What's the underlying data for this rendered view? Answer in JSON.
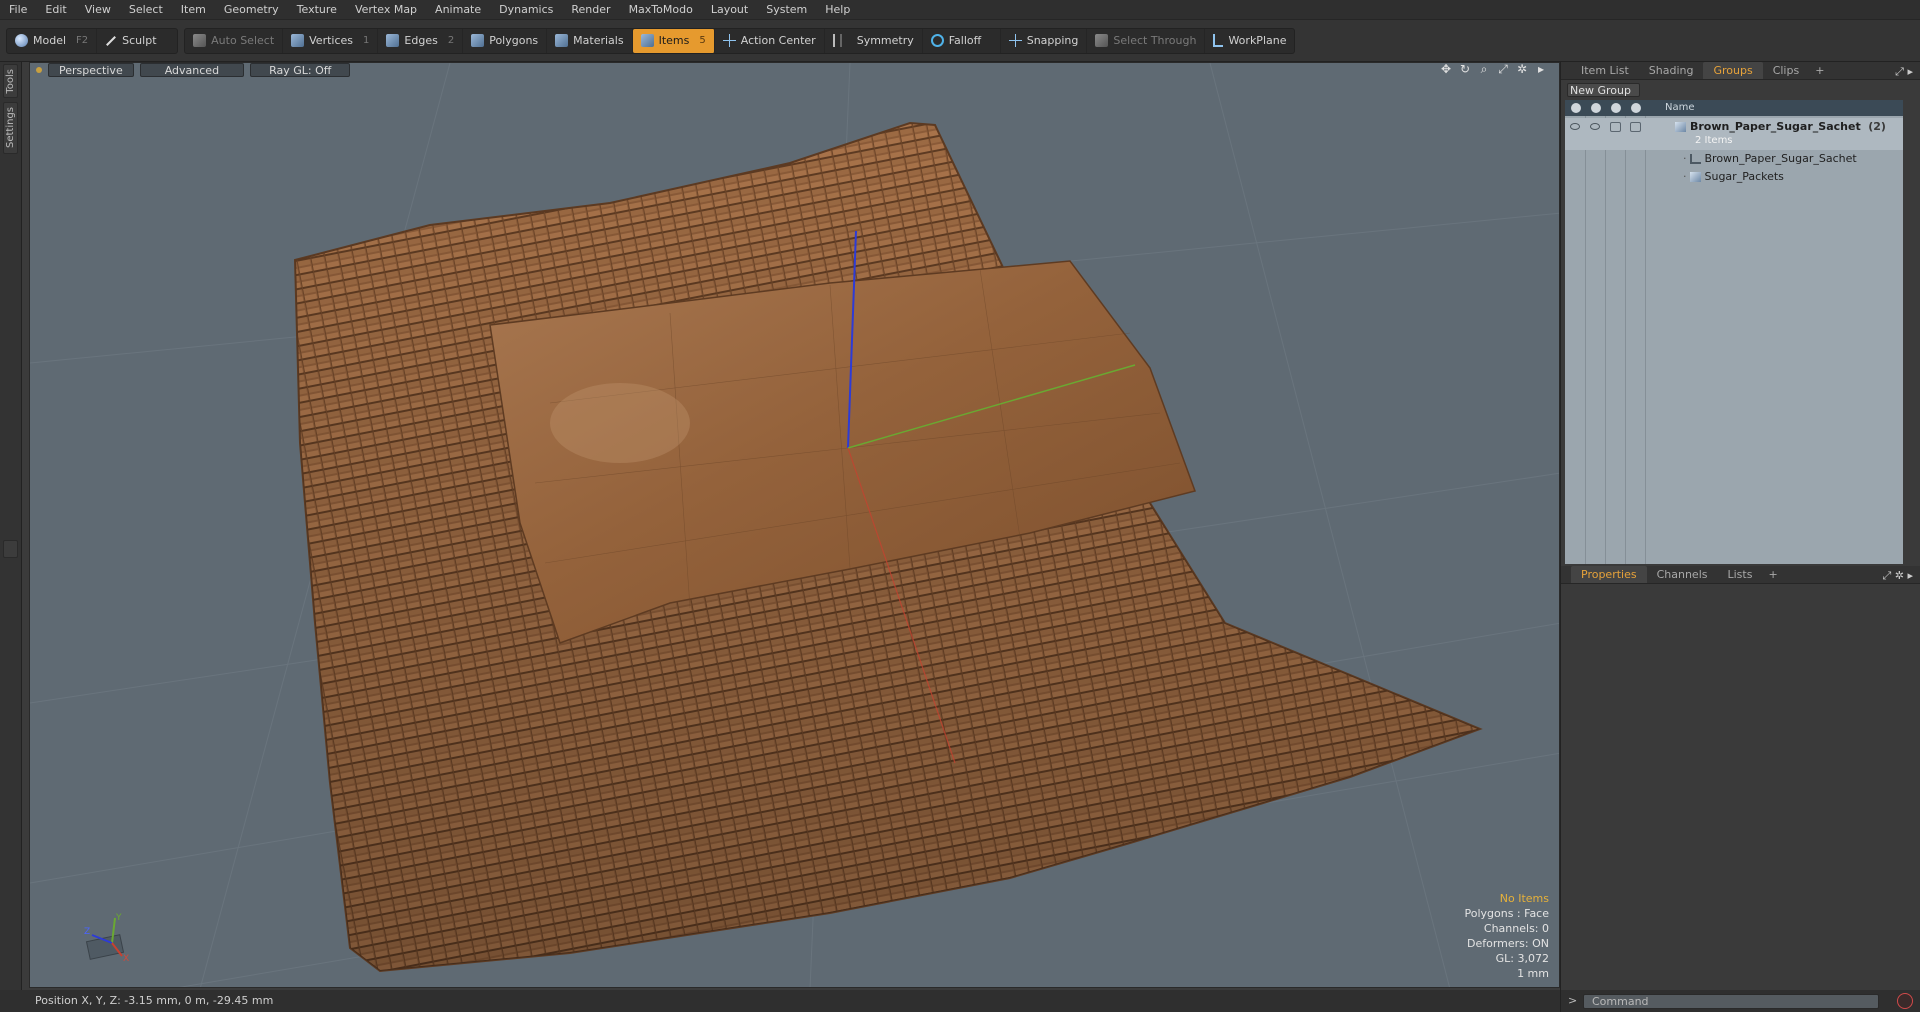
{
  "menu": [
    "File",
    "Edit",
    "View",
    "Select",
    "Item",
    "Geometry",
    "Texture",
    "Vertex Map",
    "Animate",
    "Dynamics",
    "Render",
    "MaxToModo",
    "Layout",
    "System",
    "Help"
  ],
  "toolbar": {
    "model": "Model",
    "model_key": "F2",
    "sculpt": "Sculpt",
    "auto_select": "Auto Select",
    "vertices": "Vertices",
    "vertices_key": "1",
    "edges": "Edges",
    "edges_key": "2",
    "polygons": "Polygons",
    "materials": "Materials",
    "items": "Items",
    "items_key": "5",
    "action_center": "Action Center",
    "symmetry": "Symmetry",
    "falloff": "Falloff",
    "snapping": "Snapping",
    "select_through": "Select Through",
    "workplane": "WorkPlane"
  },
  "left_tabs": [
    "Tools",
    "Settings"
  ],
  "viewport": {
    "tabs": [
      "Perspective",
      "Advanced",
      "Ray GL: Off"
    ],
    "info": {
      "selection": "No Items",
      "polygons": "Polygons : Face",
      "channels": "Channels: 0",
      "deformers": "Deformers: ON",
      "gl": "GL: 3,072",
      "scale": "1 mm"
    },
    "axis_labels": {
      "x": "X",
      "y": "Y",
      "z": "Z"
    }
  },
  "status": {
    "position": "Position X, Y, Z:  -3.15 mm, 0 m, -29.45 mm"
  },
  "top_panel": {
    "tabs": [
      "Item List",
      "Shading",
      "Groups",
      "Clips",
      "+"
    ],
    "active_tab": "Groups",
    "new_group": "New Group",
    "column_name": "Name",
    "group_name": "Brown_Paper_Sugar_Sachet",
    "group_count": "(2)",
    "group_subtitle": "2 Items",
    "children": [
      "Brown_Paper_Sugar_Sachet",
      "Sugar_Packets"
    ]
  },
  "bottom_panel": {
    "tabs": [
      "Properties",
      "Channels",
      "Lists",
      "+"
    ],
    "active_tab": "Properties"
  },
  "command": {
    "placeholder": "Command"
  },
  "colors": {
    "accent": "#e69a2e",
    "viewport_bg": "#5f6a73",
    "sachet": "#8a5a36",
    "axis_x": "#c8412f",
    "axis_y": "#6aa832",
    "axis_z": "#2d3bd6"
  }
}
